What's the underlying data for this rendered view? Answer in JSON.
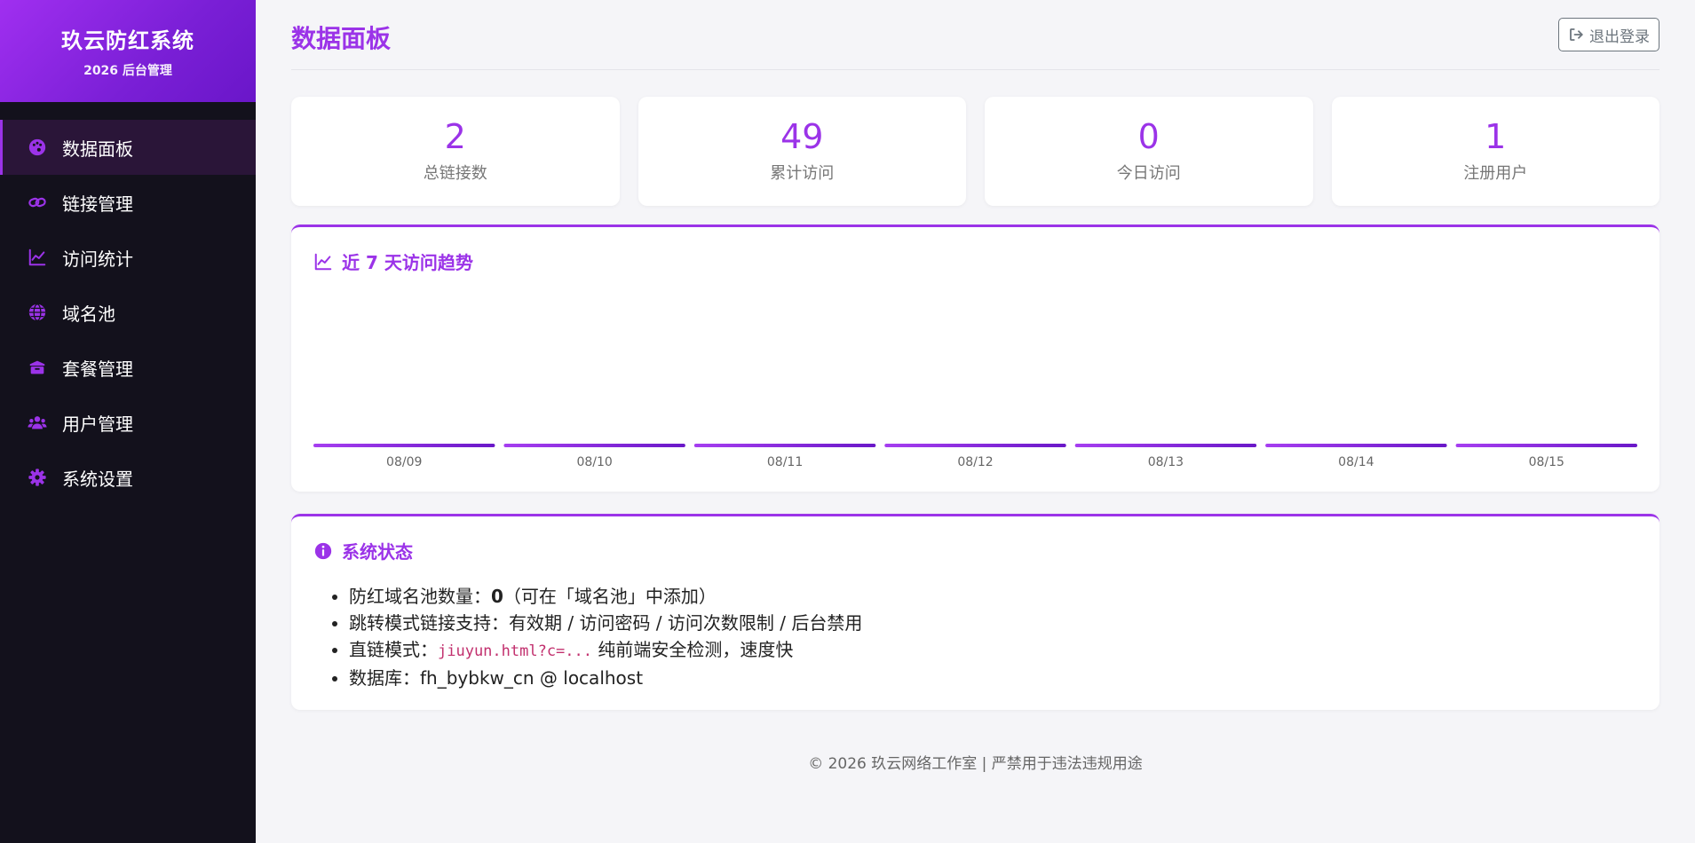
{
  "brand": {
    "title": "玖云防红系统",
    "subtitle": "2026 后台管理"
  },
  "nav": [
    {
      "label": "数据面板",
      "icon": "palette-icon",
      "active": true
    },
    {
      "label": "链接管理",
      "icon": "link-icon",
      "active": false
    },
    {
      "label": "访问统计",
      "icon": "line-chart-icon",
      "active": false
    },
    {
      "label": "域名池",
      "icon": "globe-icon",
      "active": false
    },
    {
      "label": "套餐管理",
      "icon": "box-icon",
      "active": false
    },
    {
      "label": "用户管理",
      "icon": "users-icon",
      "active": false
    },
    {
      "label": "系统设置",
      "icon": "gear-icon",
      "active": false
    }
  ],
  "header": {
    "title": "数据面板",
    "logout_label": "退出登录"
  },
  "stats": [
    {
      "value": "2",
      "label": "总链接数"
    },
    {
      "value": "49",
      "label": "累计访问"
    },
    {
      "value": "0",
      "label": "今日访问"
    },
    {
      "value": "1",
      "label": "注册用户"
    }
  ],
  "trend": {
    "title": "近 7 天访问趋势"
  },
  "chart_data": {
    "type": "bar",
    "title": "近 7 天访问趋势",
    "categories": [
      "08/09",
      "08/10",
      "08/11",
      "08/12",
      "08/13",
      "08/14",
      "08/15"
    ],
    "values": [
      0,
      0,
      0,
      0,
      0,
      0,
      0
    ],
    "xlabel": "",
    "ylabel": "",
    "bar_color": "#9b33e8"
  },
  "status": {
    "title": "系统状态",
    "line1_prefix": "防红域名池数量：",
    "line1_value": "0",
    "line1_suffix": "（可在「域名池」中添加）",
    "line2": "跳转模式链接支持：有效期 / 访问密码 / 访问次数限制 / 后台禁用",
    "line3_prefix": "直链模式：",
    "line3_code": "jiuyun.html?c=...",
    "line3_suffix": " 纯前端安全检测，速度快",
    "line4": "数据库：fh_bybkw_cn @ localhost"
  },
  "footer": {
    "text": "© 2026 玖云网络工作室 | 严禁用于违法违规用途"
  },
  "colors": {
    "accent": "#9b33e8",
    "sidebar_bg": "#13111c",
    "page_bg": "#f5f5f8"
  }
}
